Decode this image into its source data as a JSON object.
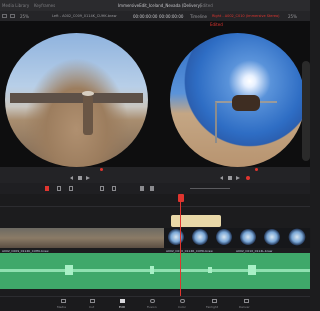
{
  "window": {
    "title": "ImmersiveEdit_Iceland_Nevada (Delivery)",
    "status": "Edited",
    "left_menu_1": "Media Library",
    "left_menu_2": "Keyframes"
  },
  "left_viewer": {
    "zoom": "25%",
    "clip_name": "Left - A002_C009_0114K_CUHK.braw",
    "timecode": "00:00:00:00"
  },
  "right_viewer": {
    "timecode_left": "00:00:00:00",
    "mode": "Timeline",
    "clip_name": "Right - A002_C010 (Immersive Stereo)",
    "zoom": "25%",
    "status_label": "Edited"
  },
  "timeline": {
    "clip_label_left": "A002_C009_0114K_CUHK.braw",
    "clip_label_right": "A002_C010_0114R_CUHK.braw",
    "clip_label_right2": "A002_C010_0114L.braw"
  },
  "pages": [
    {
      "label": "Media",
      "icon": "media-icon"
    },
    {
      "label": "Cut",
      "icon": "cut-icon"
    },
    {
      "label": "Edit",
      "icon": "edit-icon",
      "active": true
    },
    {
      "label": "Fusion",
      "icon": "fusion-icon"
    },
    {
      "label": "Color",
      "icon": "color-icon"
    },
    {
      "label": "Fairlight",
      "icon": "fairlight-icon"
    },
    {
      "label": "Deliver",
      "icon": "deliver-icon"
    }
  ],
  "colors": {
    "accent_red": "#e0352f",
    "video_track": "#6c8cc9",
    "audio_track": "#3fa86a",
    "title_clip": "#e9d8a8"
  }
}
